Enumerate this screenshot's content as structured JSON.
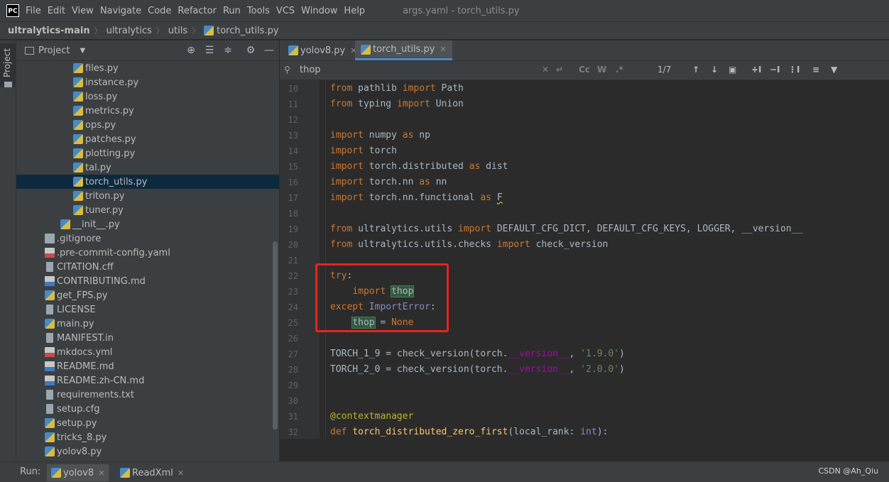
{
  "menubar": {
    "logo": "PC",
    "items": [
      "File",
      "Edit",
      "View",
      "Navigate",
      "Code",
      "Refactor",
      "Run",
      "Tools",
      "VCS",
      "Window",
      "Help"
    ],
    "title": "args.yaml - torch_utils.py"
  },
  "breadcrumb": [
    "ultralytics-main",
    "ultralytics",
    "utils",
    "torch_utils.py"
  ],
  "left_strip": {
    "tab_label": "Project"
  },
  "project_panel": {
    "title": "Project",
    "tree": [
      {
        "name": "files.py",
        "type": "py",
        "indent": 2
      },
      {
        "name": "instance.py",
        "type": "py",
        "indent": 2
      },
      {
        "name": "loss.py",
        "type": "py",
        "indent": 2
      },
      {
        "name": "metrics.py",
        "type": "py",
        "indent": 2
      },
      {
        "name": "ops.py",
        "type": "py",
        "indent": 2
      },
      {
        "name": "patches.py",
        "type": "py",
        "indent": 2
      },
      {
        "name": "plotting.py",
        "type": "py",
        "indent": 2
      },
      {
        "name": "tal.py",
        "type": "py",
        "indent": 2
      },
      {
        "name": "torch_utils.py",
        "type": "py",
        "indent": 2,
        "selected": true
      },
      {
        "name": "triton.py",
        "type": "py",
        "indent": 2
      },
      {
        "name": "tuner.py",
        "type": "py",
        "indent": 2
      },
      {
        "name": "__init__.py",
        "type": "py",
        "indent": 1
      },
      {
        "name": ".gitignore",
        "type": "git",
        "indent": 0
      },
      {
        "name": ".pre-commit-config.yaml",
        "type": "yml",
        "indent": 0
      },
      {
        "name": "CITATION.cff",
        "type": "txt",
        "indent": 0
      },
      {
        "name": "CONTRIBUTING.md",
        "type": "md",
        "indent": 0
      },
      {
        "name": "get_FPS.py",
        "type": "py",
        "indent": 0
      },
      {
        "name": "LICENSE",
        "type": "txt",
        "indent": 0
      },
      {
        "name": "main.py",
        "type": "py",
        "indent": 0
      },
      {
        "name": "MANIFEST.in",
        "type": "txt",
        "indent": 0
      },
      {
        "name": "mkdocs.yml",
        "type": "yml",
        "indent": 0
      },
      {
        "name": "README.md",
        "type": "md",
        "indent": 0
      },
      {
        "name": "README.zh-CN.md",
        "type": "md",
        "indent": 0
      },
      {
        "name": "requirements.txt",
        "type": "txt",
        "indent": 0
      },
      {
        "name": "setup.cfg",
        "type": "txt",
        "indent": 0
      },
      {
        "name": "setup.py",
        "type": "py",
        "indent": 0
      },
      {
        "name": "tricks_8.py",
        "type": "py",
        "indent": 0
      },
      {
        "name": "yolov8.py",
        "type": "py",
        "indent": 0
      }
    ]
  },
  "tabs": [
    {
      "label": "yolov8.py",
      "active": false
    },
    {
      "label": "torch_utils.py",
      "active": true
    }
  ],
  "find": {
    "query": "thop",
    "match_count": "1/7",
    "case_label": "Cc",
    "word_label": "W",
    "regex_label": ".*"
  },
  "editor": {
    "lines": [
      {
        "n": "10",
        "html": "<span class=\"kw\">from</span> pathlib <span class=\"kw\">import</span> Path"
      },
      {
        "n": "11",
        "html": "<span class=\"kw\">from</span> typing <span class=\"kw\">import</span> Union"
      },
      {
        "n": "12",
        "html": ""
      },
      {
        "n": "13",
        "html": "<span class=\"kw\">import</span> numpy <span class=\"kw\">as</span> np"
      },
      {
        "n": "14",
        "html": "<span class=\"kw\">import</span> torch"
      },
      {
        "n": "15",
        "html": "<span class=\"kw\">import</span> torch.distributed <span class=\"kw\">as</span> dist"
      },
      {
        "n": "16",
        "html": "<span class=\"kw\">import</span> torch.nn <span class=\"kw\">as</span> nn"
      },
      {
        "n": "17",
        "html": "<span class=\"kw\">import</span> torch.nn.functional <span class=\"kw\">as</span> <span class=\"warn\">F</span>"
      },
      {
        "n": "18",
        "html": ""
      },
      {
        "n": "19",
        "html": "<span class=\"kw\">from</span> ultralytics.utils <span class=\"kw\">import</span> DEFAULT_CFG_DICT, DEFAULT_CFG_KEYS, LOGGER, __version__"
      },
      {
        "n": "20",
        "html": "<span class=\"kw\">from</span> ultralytics.utils.checks <span class=\"kw\">import</span> check_version"
      },
      {
        "n": "21",
        "html": ""
      },
      {
        "n": "22",
        "html": "<span class=\"kw\">try</span>:"
      },
      {
        "n": "23",
        "html": "    <span class=\"kw\">import</span> <span class=\"hl\">thop</span>"
      },
      {
        "n": "24",
        "html": "<span class=\"kw\">except</span> <span class=\"bi\">ImportError</span>:"
      },
      {
        "n": "25",
        "html": "    <span class=\"hl\">thop</span> = <span class=\"kw\">None</span>"
      },
      {
        "n": "26",
        "html": ""
      },
      {
        "n": "27",
        "html": "TORCH_1_9 = check_version(torch.<span class=\"dunder\">__version__</span>, <span class=\"str\">'1.9.0'</span>)"
      },
      {
        "n": "28",
        "html": "TORCH_2_0 = check_version(torch.<span class=\"dunder\">__version__</span>, <span class=\"str\">'2.0.0'</span>)"
      },
      {
        "n": "29",
        "html": ""
      },
      {
        "n": "30",
        "html": ""
      },
      {
        "n": "31",
        "html": "<span class=\"dec\">@contextmanager</span>"
      },
      {
        "n": "32",
        "html": "<span class=\"kw\">def</span> <span class=\"fn\">torch_distributed_zero_first</span>(local_rank: <span class=\"bi\">int</span>):"
      }
    ]
  },
  "runbar": {
    "label": "Run:",
    "tabs": [
      {
        "label": "yolov8",
        "active": true
      },
      {
        "label": "ReadXml",
        "active": false
      }
    ]
  },
  "watermark": "CSDN @Ah_Qiu"
}
